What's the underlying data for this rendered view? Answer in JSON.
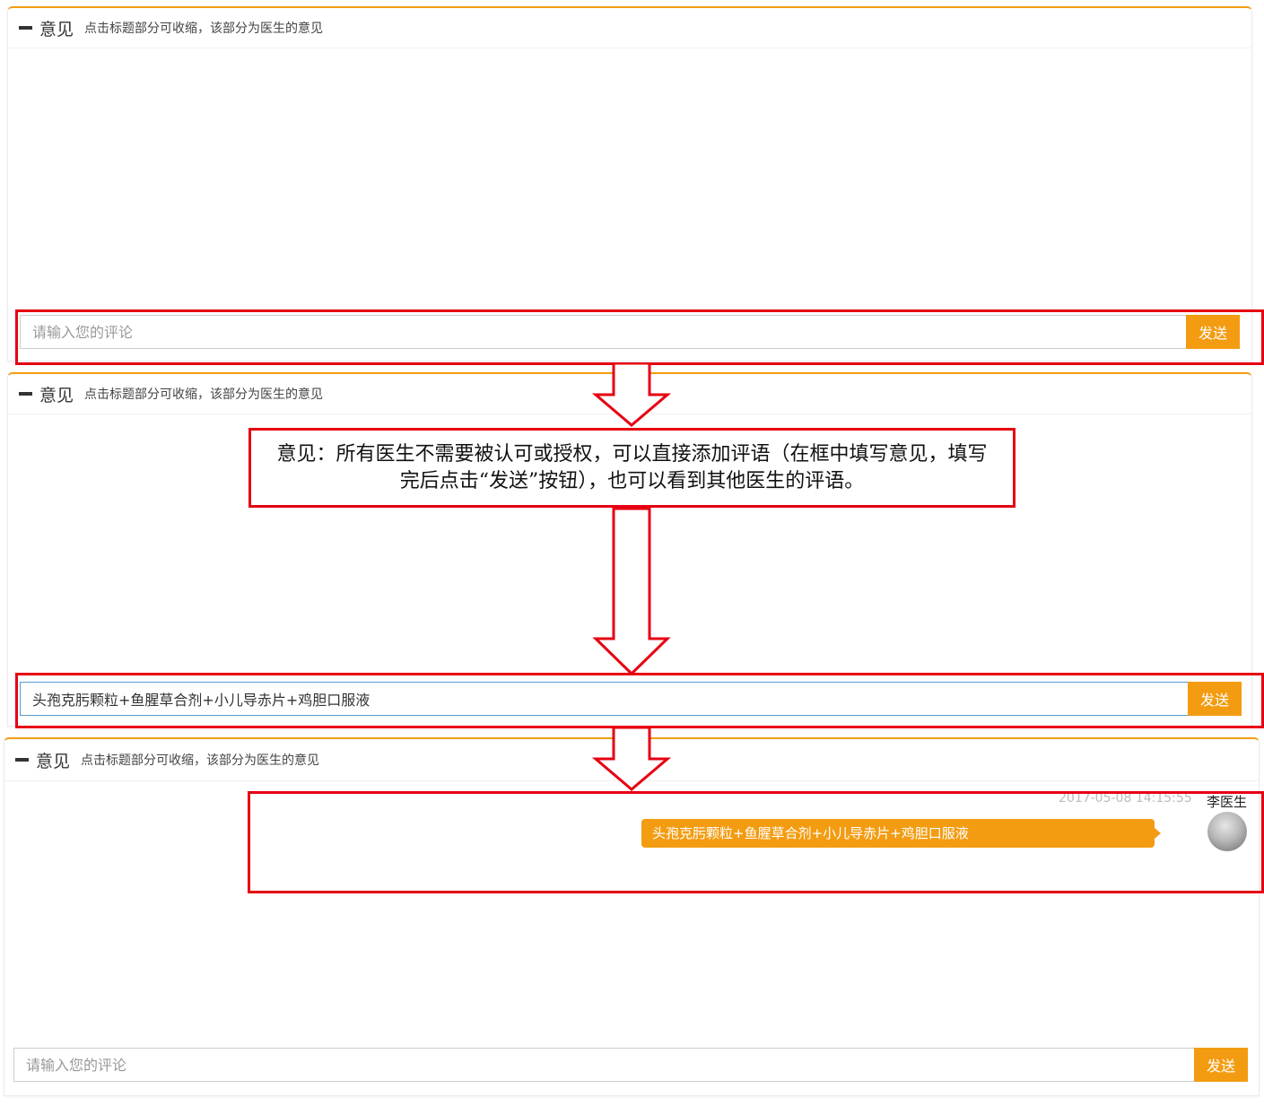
{
  "panel": {
    "title": "意见",
    "hint": "点击标题部分可收缩，该部分为医生的意见"
  },
  "input": {
    "placeholder": "请输入您的评论",
    "typed_value": "头孢克肟颗粒+鱼腥草合剂+小儿导赤片+鸡胆口服液",
    "send_label": "发送"
  },
  "callout": {
    "text": "意见：所有医生不需要被认可或授权，可以直接添加评语（在框中填写意见，填写完后点击“发送”按钮），也可以看到其他医生的评语。"
  },
  "message": {
    "timestamp": "2017-05-08 14:15:55",
    "author": "李医生",
    "text": "头孢克肟颗粒+鱼腥草合剂+小儿导赤片+鸡胆口服液"
  },
  "colors": {
    "accent": "#f39c12",
    "annotation_red": "#e60012",
    "active_border": "#5b9bd5"
  }
}
